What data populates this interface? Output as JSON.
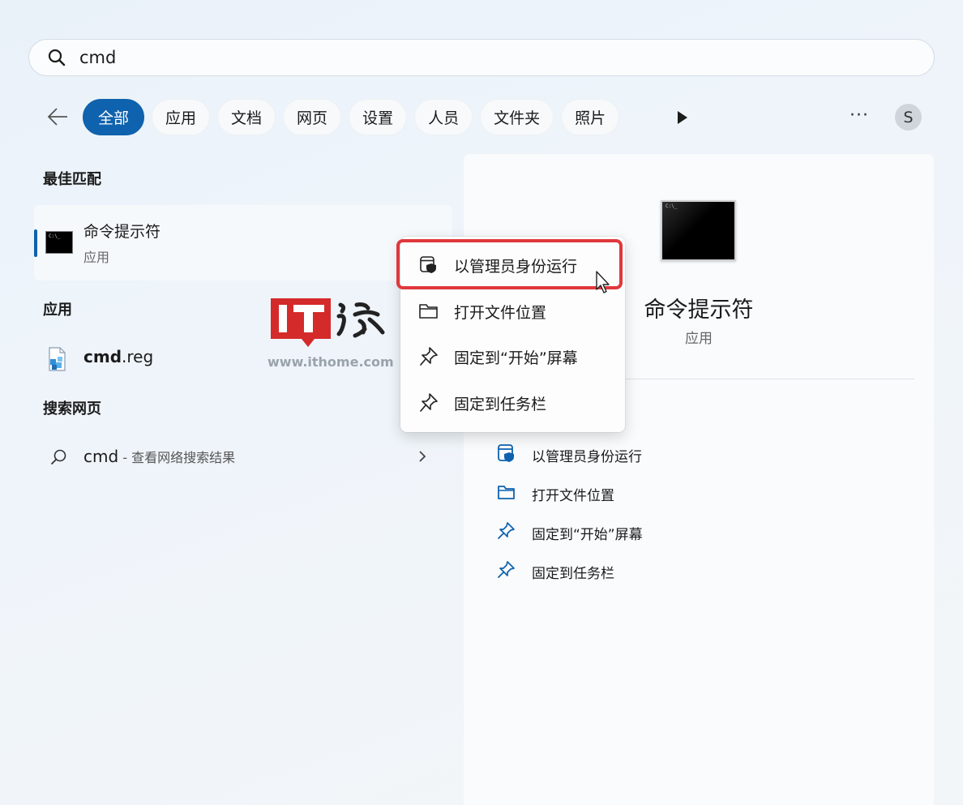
{
  "search": {
    "value": "cmd"
  },
  "filters": {
    "back_label": "",
    "chips": [
      {
        "label": "全部",
        "active": true
      },
      {
        "label": "应用"
      },
      {
        "label": "文档"
      },
      {
        "label": "网页"
      },
      {
        "label": "设置"
      },
      {
        "label": "人员"
      },
      {
        "label": "文件夹"
      },
      {
        "label": "照片"
      }
    ],
    "more": "···",
    "avatar": "S"
  },
  "best_match": {
    "heading": "最佳匹配",
    "title": "命令提示符",
    "subtitle": "应用"
  },
  "apps": {
    "heading": "应用",
    "item_bold": "cmd",
    "item_rest": ".reg"
  },
  "web": {
    "heading": "搜索网页",
    "query": "cmd",
    "suffix": " - 查看网络搜索结果"
  },
  "watermark": {
    "url": "www.ithome.com"
  },
  "detail_panel": {
    "title": "命令提示符",
    "subtitle": "应用",
    "actions": [
      {
        "label": "以管理员身份运行",
        "icon": "shield-window-icon"
      },
      {
        "label": "打开文件位置",
        "icon": "folder-icon"
      },
      {
        "label": "固定到“开始”屏幕",
        "icon": "pin-icon"
      },
      {
        "label": "固定到任务栏",
        "icon": "pin-icon"
      }
    ]
  },
  "context_menu": {
    "items": [
      {
        "label": "以管理员身份运行",
        "icon": "shield-window-icon",
        "highlighted": true
      },
      {
        "label": "打开文件位置",
        "icon": "folder-icon"
      },
      {
        "label": "固定到“开始”屏幕",
        "icon": "pin-icon"
      },
      {
        "label": "固定到任务栏",
        "icon": "pin-icon"
      }
    ]
  },
  "colors": {
    "accent": "#0f62ad",
    "highlight_border": "#e0383c",
    "watermark_red": "#d42a2a"
  }
}
